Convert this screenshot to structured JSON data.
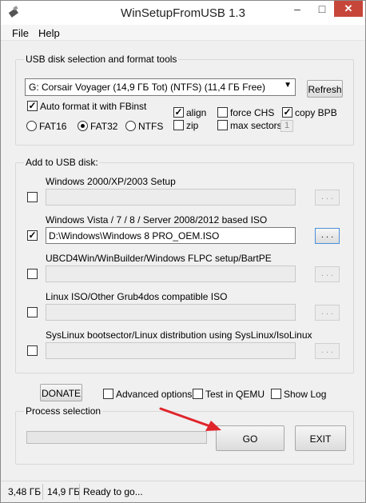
{
  "window": {
    "title": "WinSetupFromUSB 1.3"
  },
  "titlebar": {
    "minimize": "–",
    "maximize": "□",
    "close": "✕"
  },
  "menu": {
    "file": "File",
    "help": "Help"
  },
  "usb": {
    "group_label": "USB disk selection and format tools",
    "disk_value": "G: Corsair Voyager (14,9 ГБ Tot) (NTFS) (11,4 ГБ Free)",
    "refresh_label": "Refresh",
    "auto_format_label": "Auto format it with FBinst",
    "auto_format_checked": true,
    "fs_options": {
      "fat16": "FAT16",
      "fat32": "FAT32",
      "ntfs": "NTFS"
    },
    "fs_selected": "FAT32",
    "align_label": "align",
    "align_checked": true,
    "zip_label": "zip",
    "zip_checked": false,
    "force_chs_label": "force CHS",
    "force_chs_checked": false,
    "max_sectors_label": "max sectors",
    "max_sectors_checked": false,
    "max_sectors_value": "1",
    "copy_bpb_label": "copy BPB",
    "copy_bpb_checked": true
  },
  "add": {
    "group_label": "Add to USB disk:",
    "items": [
      {
        "label": "Windows 2000/XP/2003 Setup",
        "checked": false,
        "path": "",
        "browse": ". . ."
      },
      {
        "label": "Windows Vista / 7 / 8 / Server 2008/2012 based ISO",
        "checked": true,
        "path": "D:\\Windows\\Windows 8 PRO_OEM.ISO",
        "browse": ". . ."
      },
      {
        "label": "UBCD4Win/WinBuilder/Windows FLPC setup/BartPE",
        "checked": false,
        "path": "",
        "browse": ". . ."
      },
      {
        "label": "Linux ISO/Other Grub4dos compatible ISO",
        "checked": false,
        "path": "",
        "browse": ". . ."
      },
      {
        "label": "SysLinux bootsector/Linux distribution using SysLinux/IsoLinux",
        "checked": false,
        "path": "",
        "browse": ". . ."
      }
    ]
  },
  "options": {
    "donate": "DONATE",
    "advanced_label": "Advanced options",
    "advanced_checked": false,
    "qemu_label": "Test in QEMU",
    "qemu_checked": false,
    "showlog_label": "Show Log",
    "showlog_checked": false
  },
  "process": {
    "group_label": "Process selection",
    "go": "GO",
    "exit": "EXIT",
    "progress": 0
  },
  "status": {
    "cell1": "3,48 ГБ",
    "cell2": "14,9 ГБ",
    "cell3": "Ready to go..."
  },
  "colors": {
    "arrow": "#e0242b",
    "close": "#c7463a",
    "focus": "#4a8fd6"
  }
}
